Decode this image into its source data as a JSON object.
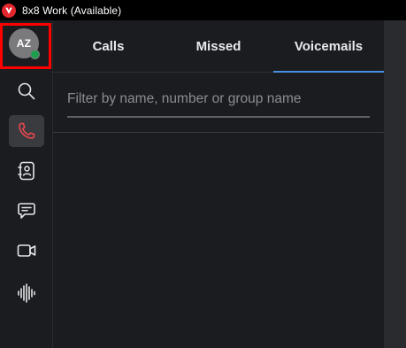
{
  "titlebar": {
    "title": "8x8 Work (Available)",
    "logo_icon": "8x8-logo-icon",
    "logo_color": "#e3262e"
  },
  "rail": {
    "avatar": {
      "initials": "AZ",
      "presence": "available",
      "presence_color": "#1d9e4d"
    },
    "items": [
      {
        "name": "search",
        "icon": "search-icon",
        "active": false
      },
      {
        "name": "calls",
        "icon": "phone-icon",
        "active": true
      },
      {
        "name": "contacts",
        "icon": "contacts-icon",
        "active": false
      },
      {
        "name": "chat",
        "icon": "chat-icon",
        "active": false
      },
      {
        "name": "video",
        "icon": "video-camera-icon",
        "active": false
      },
      {
        "name": "voice",
        "icon": "voice-waveform-icon",
        "active": false
      }
    ],
    "active_color": "#e8484f"
  },
  "main": {
    "tabs": [
      {
        "label": "Calls"
      },
      {
        "label": "Missed"
      },
      {
        "label": "Voicemails"
      }
    ],
    "selected_tab": "Voicemails",
    "accent_color": "#4a90e2",
    "filter": {
      "value": "",
      "placeholder": "Filter by name, number or group name"
    }
  }
}
